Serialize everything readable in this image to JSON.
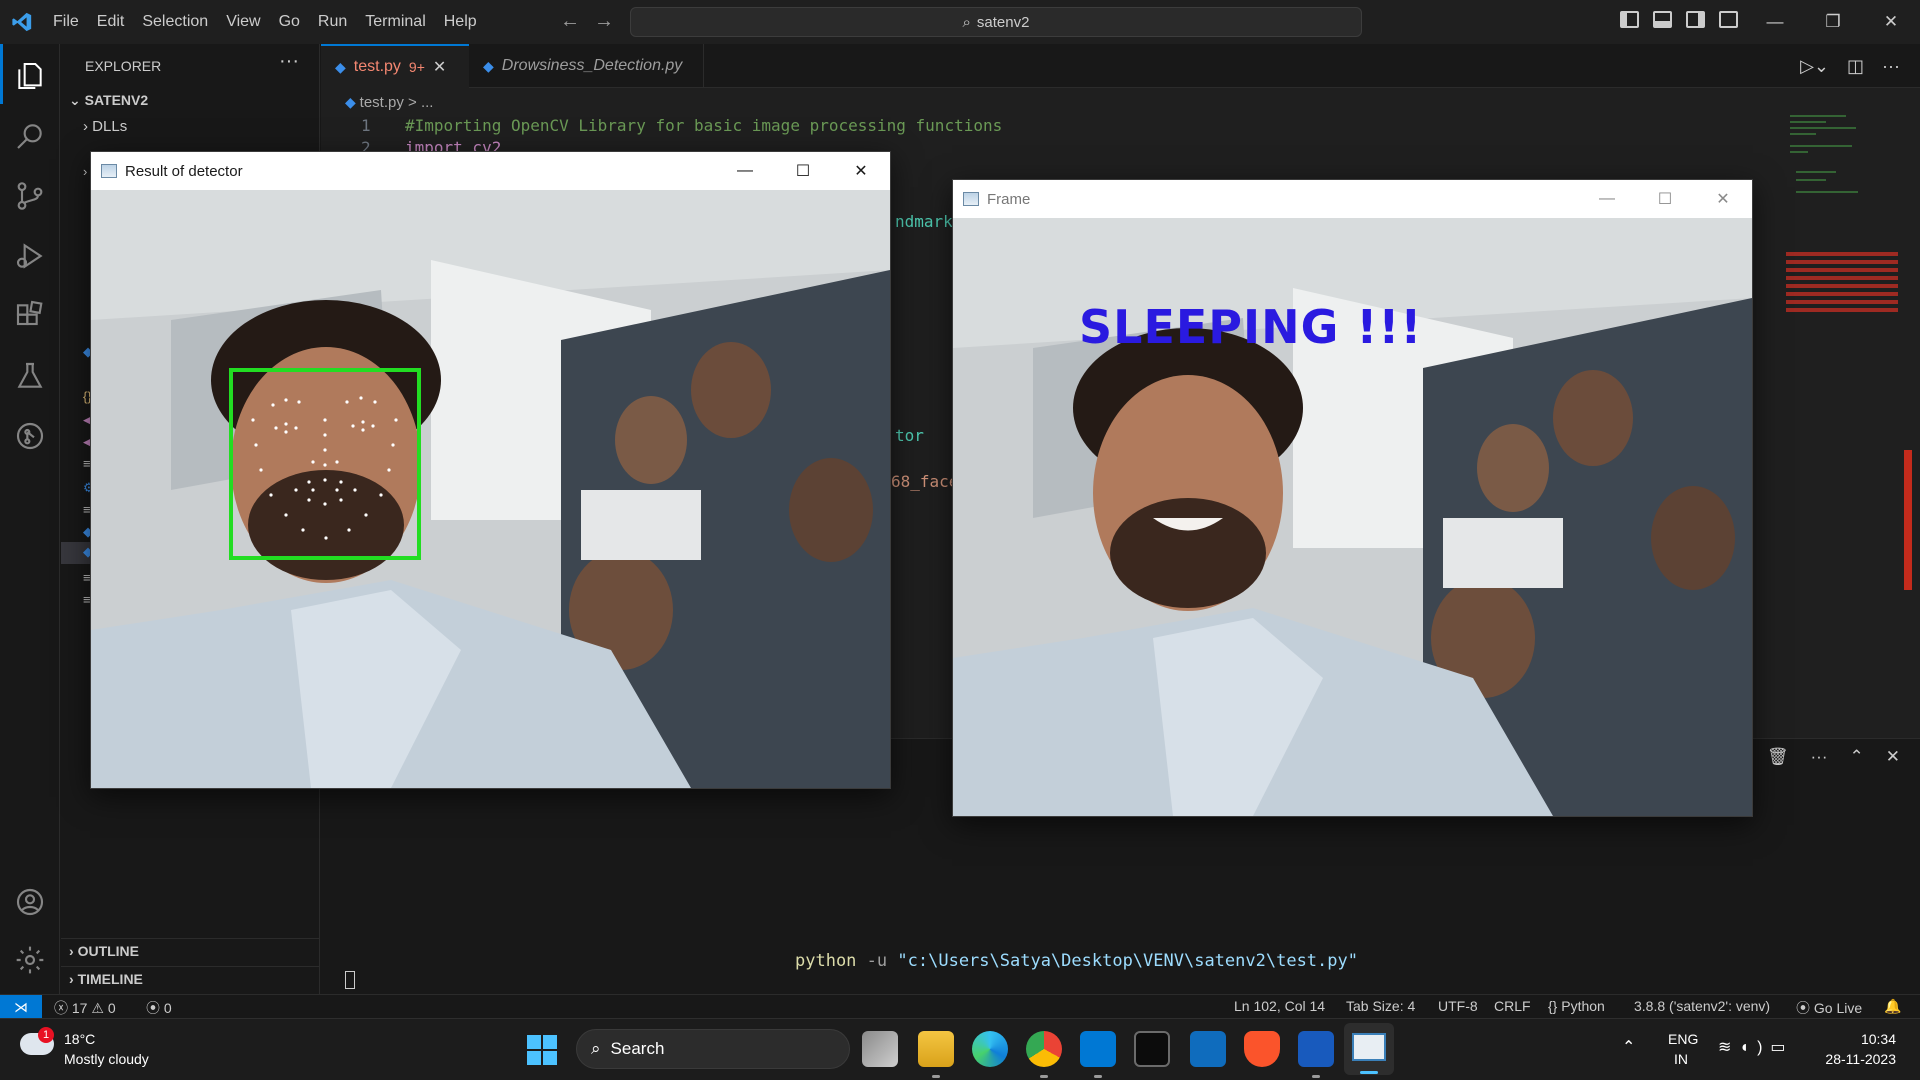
{
  "menu": [
    "File",
    "Edit",
    "Selection",
    "View",
    "Go",
    "Run",
    "Terminal",
    "Help"
  ],
  "command_center": "satenv2",
  "explorer": {
    "title": "EXPLORER",
    "workspace": "SATENV2",
    "folder": "DLLs",
    "outline": "OUTLINE",
    "timeline": "TIMELINE"
  },
  "tabs": [
    {
      "label": "test.py",
      "badge": "9+"
    },
    {
      "label": "Drowsiness_Detection.py"
    }
  ],
  "breadcrumb": "test.py > ...",
  "code": {
    "line1_no": "1",
    "line1": "#Importing OpenCV Library for basic image processing functions",
    "line2_no": "2",
    "line2": "import cv2",
    "peek_a": "ndmark",
    "peek_b": "tor",
    "peek_c": "68_face"
  },
  "terminal": {
    "cmd_prefix": "python",
    "cmd_flag": "-u",
    "cmd_path": "\"c:\\Users\\Satya\\Desktop\\VENV\\satenv2\\test.py\""
  },
  "statusbar": {
    "errors": "17",
    "warnings": "0",
    "ports": "0",
    "position": "Ln 102, Col 14",
    "tab_size": "Tab Size: 4",
    "encoding": "UTF-8",
    "eol": "CRLF",
    "language": "Python",
    "interpreter": "3.8.8 ('satenv2': venv)",
    "golive": "Go Live"
  },
  "detector_window": {
    "title": "Result of detector"
  },
  "frame_window": {
    "title": "Frame",
    "overlay_text": "SLEEPING !!!"
  },
  "taskbar": {
    "weather_temp": "18°C",
    "weather_desc": "Mostly cloudy",
    "weather_badge": "1",
    "search": "Search",
    "lang1": "ENG",
    "lang2": "IN",
    "time": "10:34",
    "date": "28-11-2023"
  },
  "colors": {
    "accent": "#0078d4",
    "face_box": "#22dd22",
    "overlay_text": "#2a1ae0"
  }
}
